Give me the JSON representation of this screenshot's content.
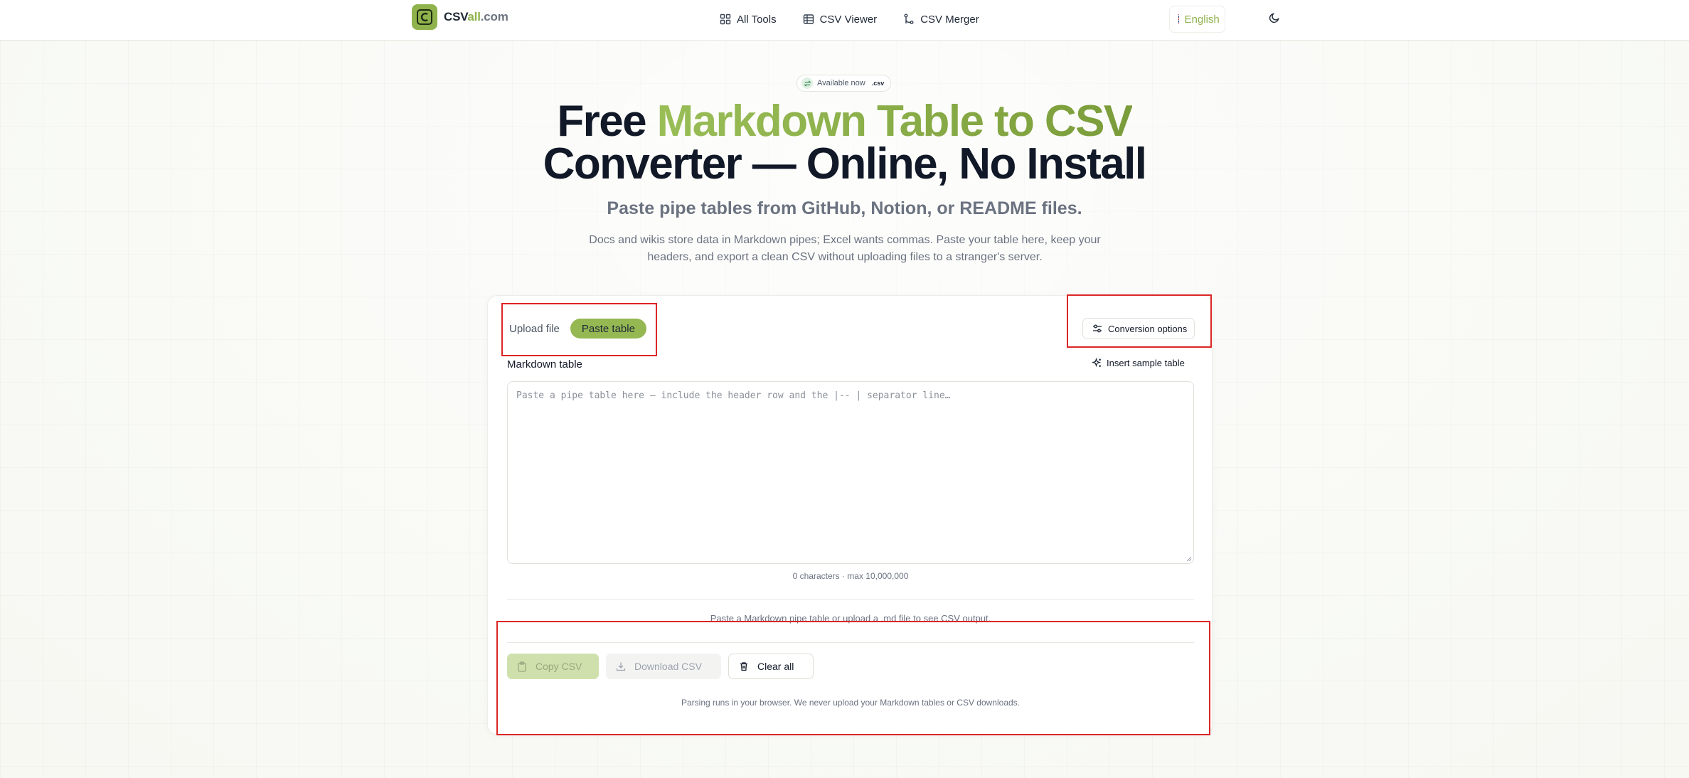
{
  "header": {
    "logo": {
      "prefix": "CSV",
      "mid": "all",
      "suffix": ".com"
    },
    "nav": [
      {
        "label": "All Tools",
        "icon": "grid-icon"
      },
      {
        "label": "CSV Viewer",
        "icon": "table-icon"
      },
      {
        "label": "CSV Merger",
        "icon": "merge-icon"
      }
    ],
    "language": "English",
    "theme_icon": "moon-icon"
  },
  "hero": {
    "badge": {
      "text": "Available now",
      "ext": ".csv"
    },
    "title_prefix": "Free ",
    "title_highlight": "Markdown Table to CSV",
    "title_line2": "Converter — Online, No Install",
    "subtitle": "Paste pipe tables from GitHub, Notion, or README files.",
    "description": "Docs and wikis store data in Markdown pipes; Excel wants commas. Paste your table here, keep your headers, and export a clean CSV without uploading files to a stranger's server."
  },
  "converter": {
    "tabs": [
      {
        "label": "Upload file",
        "active": false
      },
      {
        "label": "Paste table",
        "active": true
      }
    ],
    "options_button": "Conversion options",
    "field_label": "Markdown table",
    "sample_button": "Insert sample table",
    "textarea_value": "",
    "textarea_placeholder": "Paste a pipe table here — include the header row and the |-- | separator line…",
    "char_count": "0 characters · max 10,000,000",
    "hint": "Paste a Markdown pipe table or upload a .md file to see CSV output.",
    "buttons": {
      "copy": "Copy CSV",
      "download": "Download CSV",
      "clear": "Clear all"
    },
    "privacy": "Parsing runs in your browser. We never upload your Markdown tables or CSV downloads."
  },
  "colors": {
    "accent": "#95b853",
    "highlight_box": "#dc2626"
  }
}
